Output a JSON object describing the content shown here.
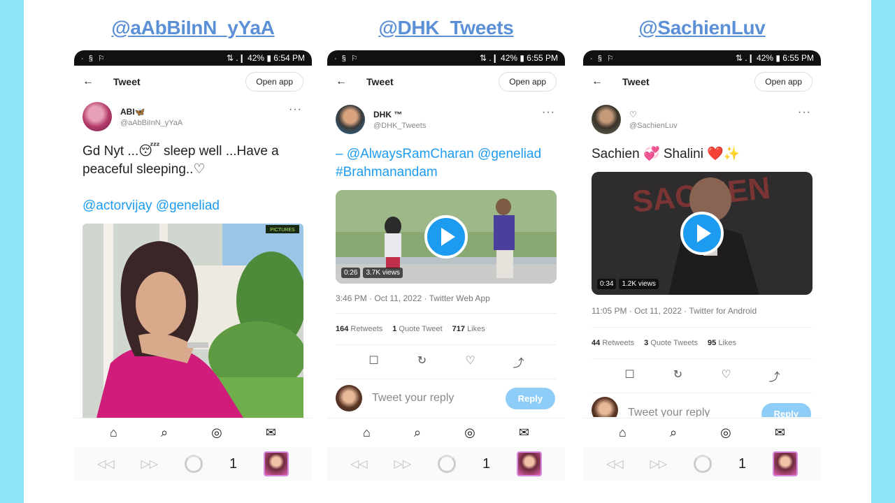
{
  "colors": {
    "background": "#8fe3f7",
    "handle": "#5b8fd6",
    "accent": "#1d9bf0",
    "reply_button": "#8ecdf8"
  },
  "columns": [
    {
      "handle": "@aAbBiInN_yYaA",
      "status": {
        "left": "· § ⚐",
        "right": "⇅ .❙ 42% ▮ 6:54 PM"
      },
      "topbar": {
        "back_icon": "←",
        "title": "Tweet",
        "open_app": "Open app"
      },
      "author": {
        "display_name": "ABI🦋",
        "username": "@aAbBiInN_yYaA",
        "more": "···"
      },
      "text_parts": {
        "t1": "Gd Nyt ...😴 sleep well ...Have a",
        "t2": "peaceful sleeping..♡"
      },
      "mentions": "@actorvijay @geneliad",
      "media_corner": "PICTURES",
      "nav_icons": [
        "⌂",
        "⌕",
        "◎",
        "✉"
      ],
      "browser": {
        "back": "◁◁",
        "forward": "▷▷",
        "count": "1"
      }
    },
    {
      "handle": "@DHK_Tweets",
      "status": {
        "left": "· § ⚐",
        "right": "⇅ .❙ 42% ▮ 6:55 PM"
      },
      "topbar": {
        "back_icon": "←",
        "title": "Tweet",
        "open_app": "Open app"
      },
      "author": {
        "display_name": "DHK ™",
        "username": "@DHK_Tweets",
        "more": "···"
      },
      "text_parts": {
        "t1": "– @AlwaysRamCharan @geneliad",
        "t2": "#Brahmanandam"
      },
      "video": {
        "duration": "0:26",
        "views": "3.7K views"
      },
      "meta": "3:46 PM · Oct 11, 2022 · Twitter Web App",
      "stats": [
        {
          "num": "164",
          "label": "Retweets"
        },
        {
          "num": "1",
          "label": "Quote Tweet"
        },
        {
          "num": "717",
          "label": "Likes"
        }
      ],
      "actions": [
        "☐",
        "↻",
        "♡",
        "⤴"
      ],
      "reply": {
        "placeholder": "Tweet your reply",
        "button": "Reply"
      },
      "nav_icons": [
        "⌂",
        "⌕",
        "◎",
        "✉"
      ],
      "browser": {
        "back": "◁◁",
        "forward": "▷▷",
        "count": "1"
      }
    },
    {
      "handle": "@SachienLuv",
      "status": {
        "left": "· § ⚐",
        "right": "⇅ .❙ 42% ▮ 6:55 PM"
      },
      "topbar": {
        "back_icon": "←",
        "title": "Tweet",
        "open_app": "Open app"
      },
      "author": {
        "display_name": "♡",
        "username": "@SachienLuv",
        "more": "···"
      },
      "text_parts": {
        "t1": "Sachien 💞 Shalini ❤️✨"
      },
      "video": {
        "duration": "0:34",
        "views": "1.2K views",
        "poster_text": "SACHIEN"
      },
      "meta": "11:05 PM · Oct 11, 2022 · Twitter for Android",
      "stats": [
        {
          "num": "44",
          "label": "Retweets"
        },
        {
          "num": "3",
          "label": "Quote Tweets"
        },
        {
          "num": "95",
          "label": "Likes"
        }
      ],
      "actions": [
        "☐",
        "↻",
        "♡",
        "⤴"
      ],
      "reply": {
        "placeholder": "Tweet your reply",
        "button": "Reply"
      },
      "nav_icons": [
        "⌂",
        "⌕",
        "◎",
        "✉"
      ],
      "browser": {
        "back": "◁◁",
        "forward": "▷▷",
        "count": "1"
      }
    }
  ]
}
